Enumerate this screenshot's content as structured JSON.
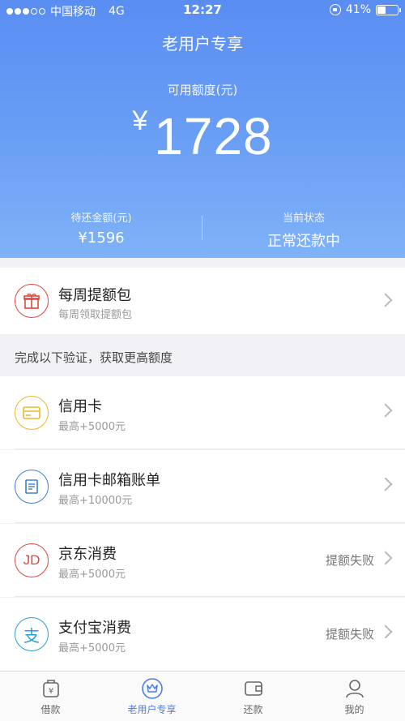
{
  "status_bar": {
    "carrier": "中国移动",
    "network": "4G",
    "time": "12:27",
    "battery": "41%",
    "battery_level": 0.41
  },
  "header": {
    "title": "老用户专享",
    "available_label": "可用额度(元)",
    "currency_symbol": "¥",
    "available_amount": "1728",
    "pending_label": "待还金额(元)",
    "pending_value": "¥1596",
    "state_label": "当前状态",
    "state_value": "正常还款中"
  },
  "weekly": {
    "title": "每周提额包",
    "subtitle": "每周领取提额包"
  },
  "verify_section": {
    "heading": "完成以下验证，获取更高额度"
  },
  "items": [
    {
      "title": "信用卡",
      "subtitle": "最高+5000元",
      "status": "",
      "icon": "credit-card-icon",
      "color": "#f0b52b"
    },
    {
      "title": "信用卡邮箱账单",
      "subtitle": "最高+10000元",
      "status": "",
      "icon": "bill-icon",
      "color": "#3d7fd6"
    },
    {
      "title": "京东消费",
      "subtitle": "最高+5000元",
      "status": "提额失败",
      "icon": "jd-icon",
      "color": "#e0473e",
      "icon_text": "JD"
    },
    {
      "title": "支付宝消费",
      "subtitle": "最高+5000元",
      "status": "提额失败",
      "icon": "alipay-icon",
      "color": "#2a9fd8",
      "icon_text": "支"
    }
  ],
  "tabs": [
    {
      "label": "借款",
      "icon": "loan-icon",
      "active": false
    },
    {
      "label": "老用户专享",
      "icon": "crown-icon",
      "active": true
    },
    {
      "label": "还款",
      "icon": "wallet-icon",
      "active": false
    },
    {
      "label": "我的",
      "icon": "profile-icon",
      "active": false
    }
  ],
  "colors": {
    "accent": "#4a7ee8",
    "gift": "#e0473e"
  }
}
